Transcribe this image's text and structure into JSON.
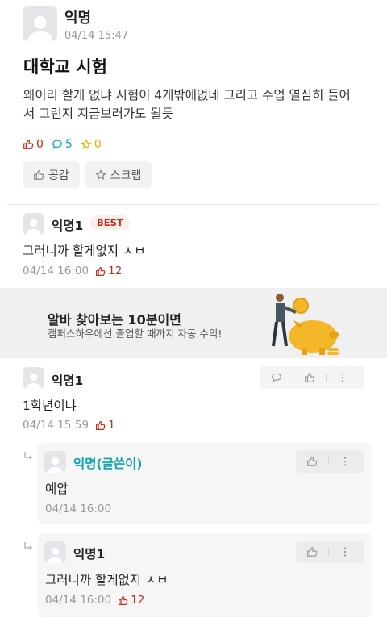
{
  "post": {
    "author": "익명",
    "time": "04/14 15:47",
    "title": "대학교 시험",
    "body": "왜이리 할게 없냐 시험이 4개밖에없네 그리고 수업 열심히 들어서 그런지 지금보러가도 될듯",
    "counts": {
      "likes": "0",
      "comments": "5",
      "scraps": "0"
    },
    "actions": {
      "like_label": "공감",
      "scrap_label": "스크랩"
    }
  },
  "ad": {
    "title": "알바 찾아보는 10분이면",
    "subtitle": "캠퍼스하우에선 졸업할 때까지 자동 수익!"
  },
  "comments": [
    {
      "author": "익명1",
      "badge": "BEST",
      "text": "그러니까 할게없지 ㅅㅂ",
      "time": "04/14 16:00",
      "votes": "12"
    },
    {
      "author": "익명1",
      "text": "1학년이냐",
      "time": "04/14 15:59",
      "votes": "1",
      "replies": [
        {
          "author": "익명(글쓴이)",
          "text": "예압",
          "time": "04/14 16:00"
        },
        {
          "author": "익명1",
          "text": "그러니까 할게없지 ㅅㅂ",
          "time": "04/14 16:00",
          "votes": "12"
        }
      ]
    }
  ],
  "icons": {
    "like": "thumbs-up-icon",
    "comment": "speech-bubble-icon",
    "scrap": "star-icon",
    "more": "more-vertical-icon",
    "reply": "reply-arrow-icon"
  },
  "colors": {
    "accent_red": "#c62917",
    "accent_teal": "#0ca5af",
    "accent_yellow": "#e8b100"
  }
}
